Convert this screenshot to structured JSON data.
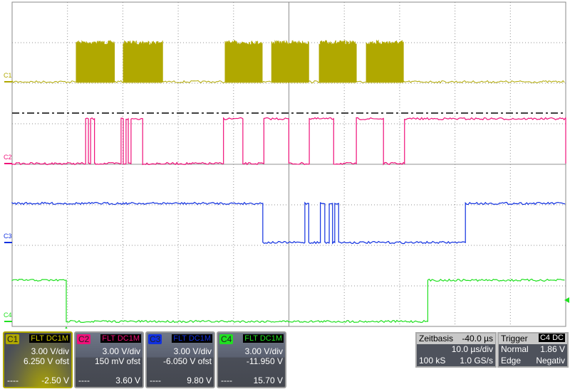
{
  "colors": {
    "c1": "#b0a800",
    "c2": "#f0107a",
    "c3": "#1030e0",
    "c4": "#20e020",
    "grid": "#909090"
  },
  "labels": {
    "c1": "C1",
    "c2": "C2",
    "c3": "C3",
    "c4": "C4"
  },
  "traces": {
    "c1": {
      "bursts_us": [
        [
          1.8,
          8.6
        ],
        [
          10.3,
          17.4
        ],
        [
          28.7,
          35.4
        ],
        [
          37.1,
          43.8
        ],
        [
          45.7,
          52.4
        ],
        [
          54.2,
          60.9
        ]
      ]
    },
    "c2": {
      "high_us": [
        [
          3.5,
          4.0
        ],
        [
          4.4,
          5.1
        ],
        [
          9.9,
          10.3
        ],
        [
          10.8,
          11.2
        ],
        [
          11.7,
          13.8
        ],
        [
          28.4,
          31.9
        ],
        [
          35.7,
          40.2
        ],
        [
          43.9,
          48.3
        ],
        [
          52.4,
          57.3
        ],
        [
          61.1,
          95
        ]
      ]
    },
    "c3": {
      "low_us": [
        [
          35.5,
          43.1
        ],
        [
          43.8,
          45.9
        ],
        [
          46.7,
          47.5
        ],
        [
          48.1,
          48.5
        ],
        [
          49.2,
          72.1
        ]
      ]
    },
    "c4": {
      "low_us": [
        [
          0,
          65.3
        ]
      ]
    }
  },
  "channels": [
    {
      "name": "C1",
      "coupling": [
        "FLT",
        "DC1M"
      ],
      "scale": "3.00 V/div",
      "offset": "6.250 V ofst",
      "dash": "----",
      "level": "-2.50 V"
    },
    {
      "name": "C2",
      "coupling": [
        "FLT",
        "DC1M"
      ],
      "scale": "3.00 V/div",
      "offset": "150 mV ofst",
      "dash": "----",
      "level": "3.60 V"
    },
    {
      "name": "C3",
      "coupling": [
        "FLT",
        "DC1M"
      ],
      "scale": "3.00 V/div",
      "offset": "-6.050 V ofst",
      "dash": "----",
      "level": "9.80 V"
    },
    {
      "name": "C4",
      "coupling": [
        "FLT",
        "DC1M"
      ],
      "scale": "3.00 V/div",
      "offset": "-11.950 V",
      "dash": "----",
      "level": "15.70 V"
    }
  ],
  "timebase": {
    "title": "Zeitbasis",
    "delay": "-40.0 µs",
    "scale": "10.0 µs/div",
    "samples": "100 kS",
    "rate": "1.0 GS/s"
  },
  "trigger": {
    "title": "Trigger",
    "source": "C4",
    "coupling": "DC",
    "mode": "Normal",
    "level": "1.86 V",
    "type": "Edge",
    "slope": "Negativ"
  }
}
